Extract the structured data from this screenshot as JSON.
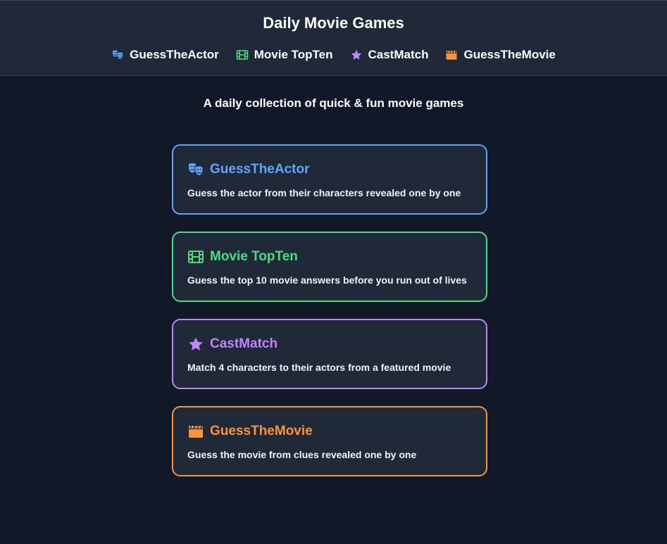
{
  "header": {
    "title": "Daily Movie Games",
    "nav": [
      {
        "label": "GuessTheActor",
        "icon": "theater-masks-icon",
        "color": "#60a5fa"
      },
      {
        "label": "Movie TopTen",
        "icon": "film-icon",
        "color": "#4ade80"
      },
      {
        "label": "CastMatch",
        "icon": "star-icon",
        "color": "#c084fc"
      },
      {
        "label": "GuessTheMovie",
        "icon": "clapperboard-icon",
        "color": "#fb923c"
      }
    ]
  },
  "tagline": "A daily collection of quick & fun movie games",
  "games": [
    {
      "title": "GuessTheActor",
      "description": "Guess the actor from their characters revealed one by one",
      "icon": "theater-masks-icon",
      "color": "#60a5fa"
    },
    {
      "title": "Movie TopTen",
      "description": "Guess the top 10 movie answers before you run out of lives",
      "icon": "film-icon",
      "color": "#4ade80"
    },
    {
      "title": "CastMatch",
      "description": "Match 4 characters to their actors from a featured movie",
      "icon": "star-icon",
      "color": "#c084fc"
    },
    {
      "title": "GuessTheMovie",
      "description": "Guess the movie from clues revealed one by one",
      "icon": "clapperboard-icon",
      "color": "#fb923c"
    }
  ]
}
